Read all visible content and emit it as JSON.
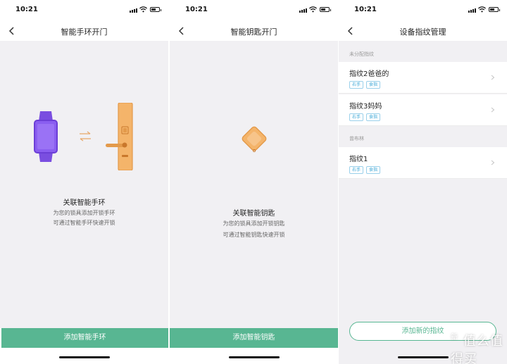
{
  "status": {
    "time": "10:21"
  },
  "screens": [
    {
      "title": "智能手环开门",
      "heading": "关联智能手环",
      "lines": [
        "为您的锁具添加开锁手环",
        "可通过智能手环快速开锁"
      ],
      "button": "添加智能手环"
    },
    {
      "title": "智能钥匙开门",
      "heading": "关联智能钥匙",
      "lines": [
        "为您的锁具添加开锁钥匙",
        "可通过智能钥匙快速开锁"
      ],
      "button": "添加智能钥匙"
    },
    {
      "title": "设备指纹管理",
      "sections": [
        {
          "label": "未分配指纹",
          "items": [
            {
              "name": "指纹2爸爸的",
              "tags": [
                "右手",
                "食指"
              ]
            },
            {
              "name": "指纹3妈妈",
              "tags": [
                "右手",
                "食指"
              ]
            }
          ]
        },
        {
          "label": "曾布林",
          "items": [
            {
              "name": "指纹1",
              "tags": [
                "右手",
                "食指"
              ]
            }
          ]
        }
      ],
      "button": "添加新的指纹"
    }
  ],
  "watermark": {
    "text": "值么值得买",
    "glyph": "新"
  },
  "colors": {
    "accent": "#58b692",
    "tag": "#3aa6d6",
    "background": "#f1f0f3"
  },
  "icons": [
    "back-icon",
    "chevron-right-icon",
    "wifi-icon",
    "battery-icon",
    "signal-icon"
  ]
}
